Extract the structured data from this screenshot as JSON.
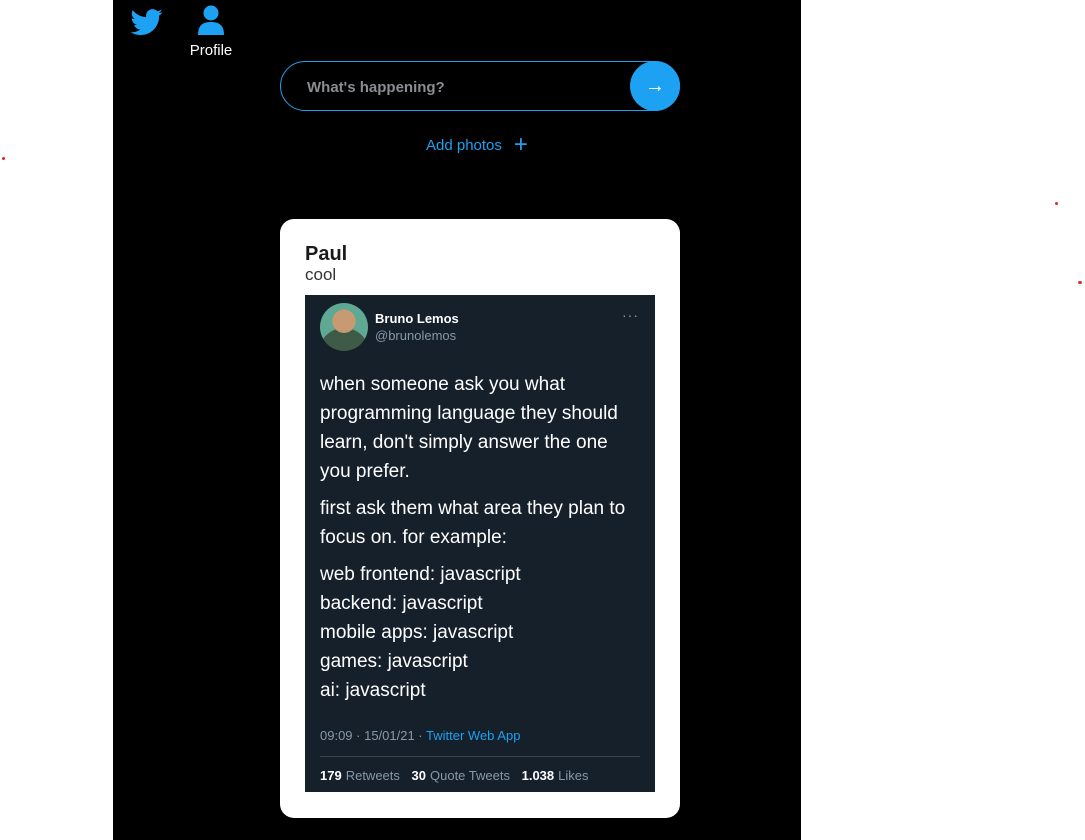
{
  "nav": {
    "twitter_icon": "twitter-bird-icon",
    "profile_icon": "user-icon",
    "profile_label": "Profile"
  },
  "composer": {
    "placeholder": "What's happening?",
    "send_glyph": "→",
    "add_photos_label": "Add photos",
    "add_photos_glyph": "+"
  },
  "post": {
    "author": "Paul",
    "caption": "cool",
    "image": {
      "name": "Bruno Lemos",
      "handle": "@brunolemos",
      "more_glyph": "···",
      "paragraphs": [
        "when someone ask you what programming language they should learn, don't simply answer the one you prefer.",
        "first ask them what area they plan to focus on. for example:"
      ],
      "lines": [
        "web frontend: javascript",
        "backend: javascript",
        "mobile apps: javascript",
        "games: javascript",
        "ai: javascript"
      ],
      "timestamp": "09:09 · 15/01/21 · ",
      "source": "Twitter Web App",
      "retweets": "179",
      "retweets_label": "Retweets",
      "quotes": "30",
      "quotes_label": "Quote Tweets",
      "likes": "1.038",
      "likes_label": "Likes"
    }
  },
  "colors": {
    "accent": "#1da1f2",
    "app_bg": "#000000",
    "tweet_bg": "#15202b"
  }
}
